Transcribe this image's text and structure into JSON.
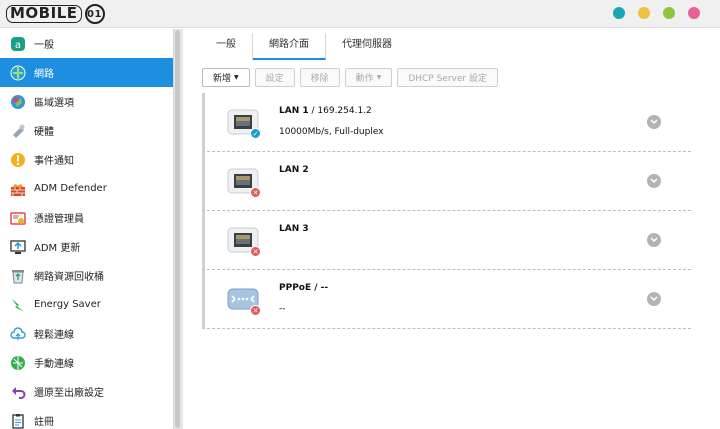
{
  "app": {
    "logo_text": "MOBILE01",
    "window_dots": [
      "#1aa7b5",
      "#f0c040",
      "#8cc63f",
      "#e8609a"
    ]
  },
  "sidebar": {
    "items": [
      {
        "label": "一般",
        "icon": "general-icon",
        "active": false
      },
      {
        "label": "網路",
        "icon": "network-icon",
        "active": true
      },
      {
        "label": "區域選項",
        "icon": "region-icon",
        "active": false
      },
      {
        "label": "硬體",
        "icon": "hardware-icon",
        "active": false
      },
      {
        "label": "事件通知",
        "icon": "notification-icon",
        "active": false
      },
      {
        "label": "ADM Defender",
        "icon": "defender-icon",
        "active": false
      },
      {
        "label": "憑證管理員",
        "icon": "certificate-icon",
        "active": false
      },
      {
        "label": "ADM 更新",
        "icon": "update-icon",
        "active": false
      },
      {
        "label": "網路資源回收桶",
        "icon": "recycle-bin-icon",
        "active": false
      },
      {
        "label": "Energy Saver",
        "icon": "energy-icon",
        "active": false
      },
      {
        "label": "輕鬆連線",
        "icon": "cloud-connect-icon",
        "active": false
      },
      {
        "label": "手動連線",
        "icon": "manual-connect-icon",
        "active": false
      },
      {
        "label": "還原至出廠設定",
        "icon": "restore-icon",
        "active": false
      },
      {
        "label": "註冊",
        "icon": "register-icon",
        "active": false
      }
    ]
  },
  "tabs": [
    {
      "label": "一般",
      "active": false
    },
    {
      "label": "網路介面",
      "active": true
    },
    {
      "label": "代理伺服器",
      "active": false
    }
  ],
  "toolbar": {
    "add": "新增",
    "settings": "設定",
    "remove": "移除",
    "action": "動作",
    "dhcp": "DHCP Server 設定"
  },
  "interfaces": [
    {
      "name": "LAN 1",
      "ip": " / 169.254.1.2",
      "detail": "10000Mb/s, Full-duplex",
      "status": "connected",
      "icon": "ethernet-port-icon"
    },
    {
      "name": "LAN 2",
      "ip": "",
      "detail": "",
      "status": "disconnected",
      "icon": "ethernet-port-icon"
    },
    {
      "name": "LAN 3",
      "ip": "",
      "detail": "",
      "status": "disconnected",
      "icon": "ethernet-port-icon"
    },
    {
      "name": "PPPoE / --",
      "ip": "",
      "detail": "--",
      "status": "disconnected",
      "icon": "pppoe-icon"
    }
  ],
  "colors": {
    "accent": "#1e8fe0",
    "connected": "#1e9ad6",
    "disconnected": "#e05a5a"
  }
}
